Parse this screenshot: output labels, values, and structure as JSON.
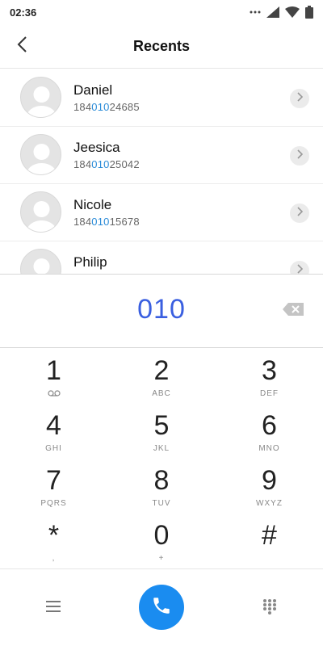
{
  "status_bar": {
    "time": "02:36"
  },
  "header": {
    "title": "Recents"
  },
  "recents": [
    {
      "name": "Daniel",
      "number_prefix": "184",
      "number_match": "010",
      "number_suffix": "24685"
    },
    {
      "name": "Jeesica",
      "number_prefix": "184",
      "number_match": "010",
      "number_suffix": "25042"
    },
    {
      "name": "Nicole",
      "number_prefix": "184",
      "number_match": "010",
      "number_suffix": "15678"
    },
    {
      "name": "Philip",
      "number_prefix": "",
      "number_match": "",
      "number_suffix": ""
    }
  ],
  "dialer": {
    "number": "010"
  },
  "keypad": [
    {
      "digit": "1",
      "letters": ""
    },
    {
      "digit": "2",
      "letters": "ABC"
    },
    {
      "digit": "3",
      "letters": "DEF"
    },
    {
      "digit": "4",
      "letters": "GHI"
    },
    {
      "digit": "5",
      "letters": "JKL"
    },
    {
      "digit": "6",
      "letters": "MNO"
    },
    {
      "digit": "7",
      "letters": "PQRS"
    },
    {
      "digit": "8",
      "letters": "TUV"
    },
    {
      "digit": "9",
      "letters": "WXYZ"
    },
    {
      "digit": "*",
      "letters": ","
    },
    {
      "digit": "0",
      "letters": "+"
    },
    {
      "digit": "#",
      "letters": ""
    }
  ],
  "icons": {
    "back": "chevron-left-icon",
    "backspace": "backspace-icon",
    "voicemail": "voicemail-icon",
    "menu": "menu-icon",
    "call": "phone-icon",
    "dialpad": "dialpad-icon"
  },
  "colors": {
    "accent": "#1a8cf0",
    "dialed_number": "#3a5fe0",
    "number_highlight": "#2a8bd8"
  }
}
